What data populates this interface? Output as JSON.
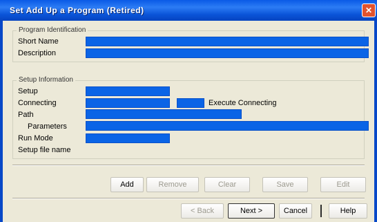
{
  "window": {
    "title": "Set Add Up a Program (Retired)",
    "close_glyph": "✕"
  },
  "identification": {
    "legend": "Program Identification",
    "fields": [
      {
        "label": "Short Name"
      },
      {
        "label": "Description"
      }
    ]
  },
  "setup": {
    "legend": "Setup Information",
    "fields": [
      {
        "label": "Setup"
      },
      {
        "label": "Connecting",
        "extra": "Execute Connecting"
      },
      {
        "label": "Path"
      },
      {
        "label": "Parameters"
      },
      {
        "label": "Run Mode"
      }
    ],
    "note": "Setup file name"
  },
  "buttons_row1": [
    {
      "label": "Add"
    },
    {
      "label": "Remove"
    },
    {
      "label": "Clear"
    },
    {
      "label": "Save"
    },
    {
      "label": "Edit"
    }
  ],
  "buttons_row2": [
    {
      "label": "< Back"
    },
    {
      "label": "Next >"
    },
    {
      "label": "Cancel"
    },
    {
      "label": "Help"
    }
  ],
  "colors": {
    "titlebar": "#0a54d8",
    "field_fill": "#0a64e6",
    "dialog_bg": "#ece9d8",
    "close_button": "#e2532e"
  },
  "icons": {
    "close": "close-icon"
  }
}
